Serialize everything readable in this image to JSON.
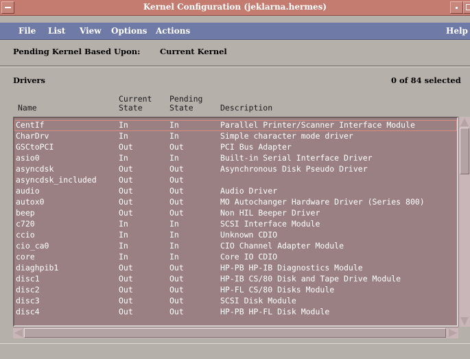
{
  "window": {
    "title": "Kernel Configuration (jeklarna.hermes)"
  },
  "menu": {
    "file": "File",
    "list": "List",
    "view": "View",
    "options": "Options",
    "actions": "Actions",
    "help": "Help"
  },
  "pending": {
    "label": "Pending Kernel Based Upon:",
    "value": "Current Kernel"
  },
  "drivers": {
    "title": "Drivers",
    "selected": "0 of 84 selected",
    "columns": {
      "name": "Name",
      "current": [
        "Current",
        "State"
      ],
      "pending": [
        "Pending",
        "State"
      ],
      "description": "Description"
    },
    "rows": [
      [
        "CentIf",
        "In",
        "In",
        "Parallel Printer/Scanner Interface Module"
      ],
      [
        "CharDrv",
        "In",
        "In",
        "Simple character mode driver"
      ],
      [
        "GSCtoPCI",
        "Out",
        "Out",
        "PCI Bus Adapter"
      ],
      [
        "asio0",
        "In",
        "In",
        "Built-in Serial Interface Driver"
      ],
      [
        "asyncdsk",
        "Out",
        "Out",
        "Asynchronous Disk Pseudo Driver"
      ],
      [
        "asyncdsk_included",
        "Out",
        "Out",
        ""
      ],
      [
        "audio",
        "Out",
        "Out",
        "Audio Driver"
      ],
      [
        "autox0",
        "Out",
        "Out",
        "MO Autochanger Hardware Driver (Series 800)"
      ],
      [
        "beep",
        "Out",
        "Out",
        "Non HIL Beeper Driver"
      ],
      [
        "c720",
        "In",
        "In",
        "SCSI Interface Module"
      ],
      [
        "ccio",
        "In",
        "In",
        "Unknown CDIO"
      ],
      [
        "cio_ca0",
        "In",
        "In",
        "CIO Channel Adapter Module"
      ],
      [
        "core",
        "In",
        "In",
        "Core IO CDIO"
      ],
      [
        "diaghpib1",
        "Out",
        "Out",
        "HP-PB HP-IB Diagnostics Module"
      ],
      [
        "disc1",
        "Out",
        "Out",
        "HP-IB CS/80 Disk and Tape Drive Module"
      ],
      [
        "disc2",
        "Out",
        "Out",
        "HP-FL CS/80 Disks Module"
      ],
      [
        "disc3",
        "Out",
        "Out",
        "SCSI Disk Module"
      ],
      [
        "disc4",
        "Out",
        "Out",
        "HP-PB HP-FL Disk Module"
      ]
    ]
  }
}
